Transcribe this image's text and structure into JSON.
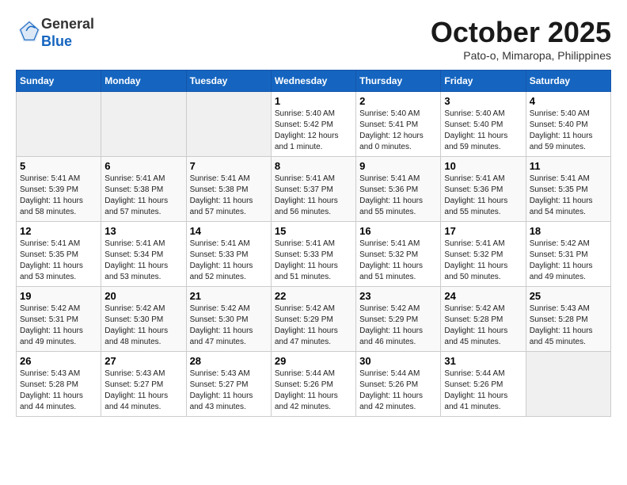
{
  "header": {
    "logo_general": "General",
    "logo_blue": "Blue",
    "month_title": "October 2025",
    "location": "Pato-o, Mimaropa, Philippines"
  },
  "weekdays": [
    "Sunday",
    "Monday",
    "Tuesday",
    "Wednesday",
    "Thursday",
    "Friday",
    "Saturday"
  ],
  "weeks": [
    [
      {
        "day": "",
        "info": ""
      },
      {
        "day": "",
        "info": ""
      },
      {
        "day": "",
        "info": ""
      },
      {
        "day": "1",
        "info": "Sunrise: 5:40 AM\nSunset: 5:42 PM\nDaylight: 12 hours\nand 1 minute."
      },
      {
        "day": "2",
        "info": "Sunrise: 5:40 AM\nSunset: 5:41 PM\nDaylight: 12 hours\nand 0 minutes."
      },
      {
        "day": "3",
        "info": "Sunrise: 5:40 AM\nSunset: 5:40 PM\nDaylight: 11 hours\nand 59 minutes."
      },
      {
        "day": "4",
        "info": "Sunrise: 5:40 AM\nSunset: 5:40 PM\nDaylight: 11 hours\nand 59 minutes."
      }
    ],
    [
      {
        "day": "5",
        "info": "Sunrise: 5:41 AM\nSunset: 5:39 PM\nDaylight: 11 hours\nand 58 minutes."
      },
      {
        "day": "6",
        "info": "Sunrise: 5:41 AM\nSunset: 5:38 PM\nDaylight: 11 hours\nand 57 minutes."
      },
      {
        "day": "7",
        "info": "Sunrise: 5:41 AM\nSunset: 5:38 PM\nDaylight: 11 hours\nand 57 minutes."
      },
      {
        "day": "8",
        "info": "Sunrise: 5:41 AM\nSunset: 5:37 PM\nDaylight: 11 hours\nand 56 minutes."
      },
      {
        "day": "9",
        "info": "Sunrise: 5:41 AM\nSunset: 5:36 PM\nDaylight: 11 hours\nand 55 minutes."
      },
      {
        "day": "10",
        "info": "Sunrise: 5:41 AM\nSunset: 5:36 PM\nDaylight: 11 hours\nand 55 minutes."
      },
      {
        "day": "11",
        "info": "Sunrise: 5:41 AM\nSunset: 5:35 PM\nDaylight: 11 hours\nand 54 minutes."
      }
    ],
    [
      {
        "day": "12",
        "info": "Sunrise: 5:41 AM\nSunset: 5:35 PM\nDaylight: 11 hours\nand 53 minutes."
      },
      {
        "day": "13",
        "info": "Sunrise: 5:41 AM\nSunset: 5:34 PM\nDaylight: 11 hours\nand 53 minutes."
      },
      {
        "day": "14",
        "info": "Sunrise: 5:41 AM\nSunset: 5:33 PM\nDaylight: 11 hours\nand 52 minutes."
      },
      {
        "day": "15",
        "info": "Sunrise: 5:41 AM\nSunset: 5:33 PM\nDaylight: 11 hours\nand 51 minutes."
      },
      {
        "day": "16",
        "info": "Sunrise: 5:41 AM\nSunset: 5:32 PM\nDaylight: 11 hours\nand 51 minutes."
      },
      {
        "day": "17",
        "info": "Sunrise: 5:41 AM\nSunset: 5:32 PM\nDaylight: 11 hours\nand 50 minutes."
      },
      {
        "day": "18",
        "info": "Sunrise: 5:42 AM\nSunset: 5:31 PM\nDaylight: 11 hours\nand 49 minutes."
      }
    ],
    [
      {
        "day": "19",
        "info": "Sunrise: 5:42 AM\nSunset: 5:31 PM\nDaylight: 11 hours\nand 49 minutes."
      },
      {
        "day": "20",
        "info": "Sunrise: 5:42 AM\nSunset: 5:30 PM\nDaylight: 11 hours\nand 48 minutes."
      },
      {
        "day": "21",
        "info": "Sunrise: 5:42 AM\nSunset: 5:30 PM\nDaylight: 11 hours\nand 47 minutes."
      },
      {
        "day": "22",
        "info": "Sunrise: 5:42 AM\nSunset: 5:29 PM\nDaylight: 11 hours\nand 47 minutes."
      },
      {
        "day": "23",
        "info": "Sunrise: 5:42 AM\nSunset: 5:29 PM\nDaylight: 11 hours\nand 46 minutes."
      },
      {
        "day": "24",
        "info": "Sunrise: 5:42 AM\nSunset: 5:28 PM\nDaylight: 11 hours\nand 45 minutes."
      },
      {
        "day": "25",
        "info": "Sunrise: 5:43 AM\nSunset: 5:28 PM\nDaylight: 11 hours\nand 45 minutes."
      }
    ],
    [
      {
        "day": "26",
        "info": "Sunrise: 5:43 AM\nSunset: 5:28 PM\nDaylight: 11 hours\nand 44 minutes."
      },
      {
        "day": "27",
        "info": "Sunrise: 5:43 AM\nSunset: 5:27 PM\nDaylight: 11 hours\nand 44 minutes."
      },
      {
        "day": "28",
        "info": "Sunrise: 5:43 AM\nSunset: 5:27 PM\nDaylight: 11 hours\nand 43 minutes."
      },
      {
        "day": "29",
        "info": "Sunrise: 5:44 AM\nSunset: 5:26 PM\nDaylight: 11 hours\nand 42 minutes."
      },
      {
        "day": "30",
        "info": "Sunrise: 5:44 AM\nSunset: 5:26 PM\nDaylight: 11 hours\nand 42 minutes."
      },
      {
        "day": "31",
        "info": "Sunrise: 5:44 AM\nSunset: 5:26 PM\nDaylight: 11 hours\nand 41 minutes."
      },
      {
        "day": "",
        "info": ""
      }
    ]
  ]
}
